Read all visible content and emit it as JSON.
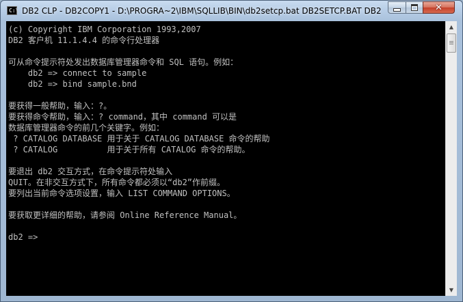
{
  "window": {
    "title": "DB2 CLP - DB2COPY1 - D:\\PROGRA~2\\IBM\\SQLLIB\\BIN\\db2setcp.bat  DB2SETCP.BAT DB2...",
    "icon_text": "C:\\"
  },
  "controls": {
    "minimize_icon": "minimize-icon",
    "maximize_icon": "maximize-icon",
    "close_icon": "close-icon",
    "close_glyph": "✕"
  },
  "console": {
    "lines": [
      "(c) Copyright IBM Corporation 1993,2007",
      "DB2 客户机 11.1.4.4 的命令行处理器",
      "",
      "可从命令提示符处发出数据库管理器命令和 SQL 语句。例如：",
      "    db2 => connect to sample",
      "    db2 => bind sample.bnd",
      "",
      "要获得一般帮助，输入：?。",
      "要获得命令帮助，输入：? command，其中 command 可以是",
      "数据库管理器命令的前几个关键字。例如：",
      " ? CATALOG DATABASE 用于关于 CATALOG DATABASE 命令的帮助",
      " ? CATALOG          用于关于所有 CATALOG 命令的帮助。",
      "",
      "要退出 db2 交互方式，在命令提示符处输入",
      "QUIT。在非交互方式下，所有命令都必须以“db2”作前缀。",
      "要列出当前命令选项设置，输入 LIST COMMAND OPTIONS。",
      "",
      "要获取更详细的帮助，请参阅 Online Reference Manual。",
      "",
      "db2 =>"
    ]
  },
  "scrollbar": {
    "up_arrow": "▲",
    "down_arrow": "▼"
  }
}
